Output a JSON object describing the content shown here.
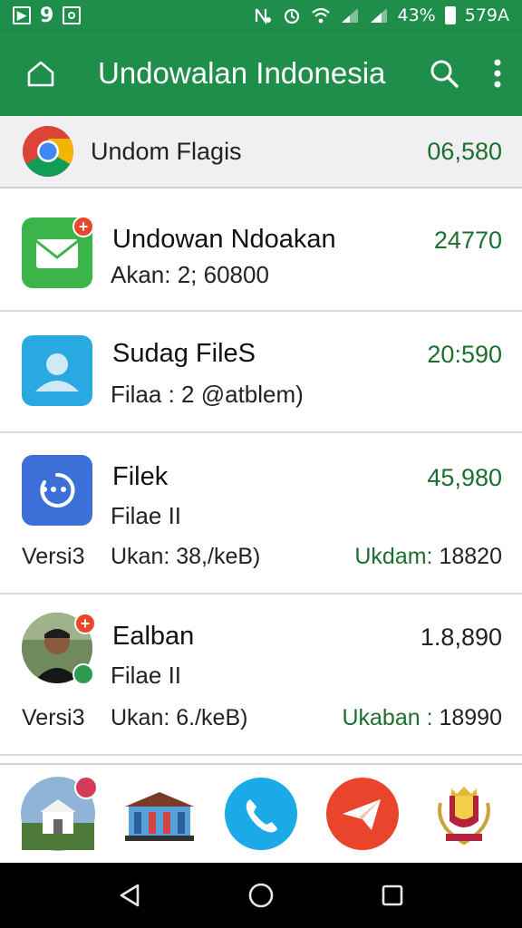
{
  "status_bar": {
    "left_glyph_1": "▶",
    "left_text": "9",
    "battery_text": "43%",
    "time_text": "579A"
  },
  "app_bar": {
    "title": "Undowalan Indonesia",
    "home_icon": "home-icon",
    "search_icon": "search-icon",
    "menu_icon": "more-vert-icon",
    "color": "#1e8e4a"
  },
  "top_row": {
    "name": "Undom Flagis",
    "value": "06,580"
  },
  "items": [
    {
      "title": "Undowan Ndoakan",
      "sub": "Akan: 2; 60800",
      "value": "24770",
      "badge": "+"
    },
    {
      "title": "Sudag FileS",
      "sub": "Filaa : 2 @atblem)",
      "value": "20:590"
    },
    {
      "title": "Filek",
      "sub": "Filae II",
      "value": "45,980",
      "foot_left": "Versi3",
      "foot_mid": "Ukan: 38,/keB)",
      "foot_right_label": "Ukdam:",
      "foot_right_value": "18820"
    },
    {
      "title": "Ealban",
      "sub": "Filae II",
      "value": "1.8,890",
      "foot_left": "Versi3",
      "foot_mid": "Ukan: 6./keB)",
      "foot_right_label": "Ukaban :",
      "foot_right_value": "18990",
      "badge": "+"
    }
  ],
  "dock": {
    "apps": [
      "building-photo-app",
      "museum-app",
      "phone-app",
      "telegram-app",
      "crest-app"
    ]
  },
  "colors": {
    "accent": "#1e8e4a",
    "value_green": "#1c6f2e",
    "badge_red": "#e8472a"
  }
}
